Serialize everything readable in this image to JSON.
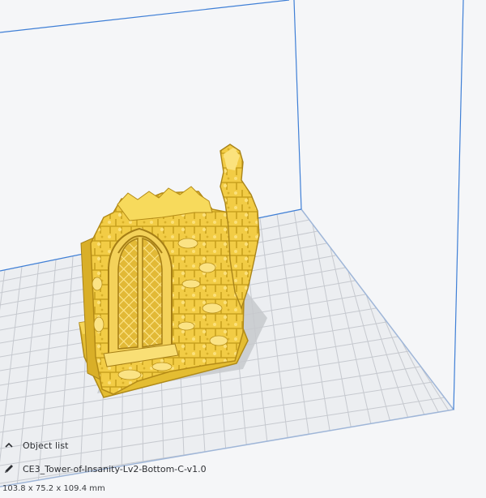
{
  "object_panel": {
    "toggle_label": "Object list",
    "toggle_icon": "chevron-up-icon",
    "edit_icon": "pencil-icon",
    "file_name": "CE3_Tower-of-Insanity-Lv2-Bottom-C-v1.0",
    "dimensions": "103.8 x 75.2 x 109.4 mm"
  },
  "colors": {
    "background": "#f5f6f8",
    "build_plate": "#e9ebee",
    "grid_line": "#c9ccd2",
    "volume_edge": "#3a7bd5",
    "model": "#f5d14a",
    "model_shadow": "#d9ad1f",
    "model_dark": "#b8901a"
  }
}
